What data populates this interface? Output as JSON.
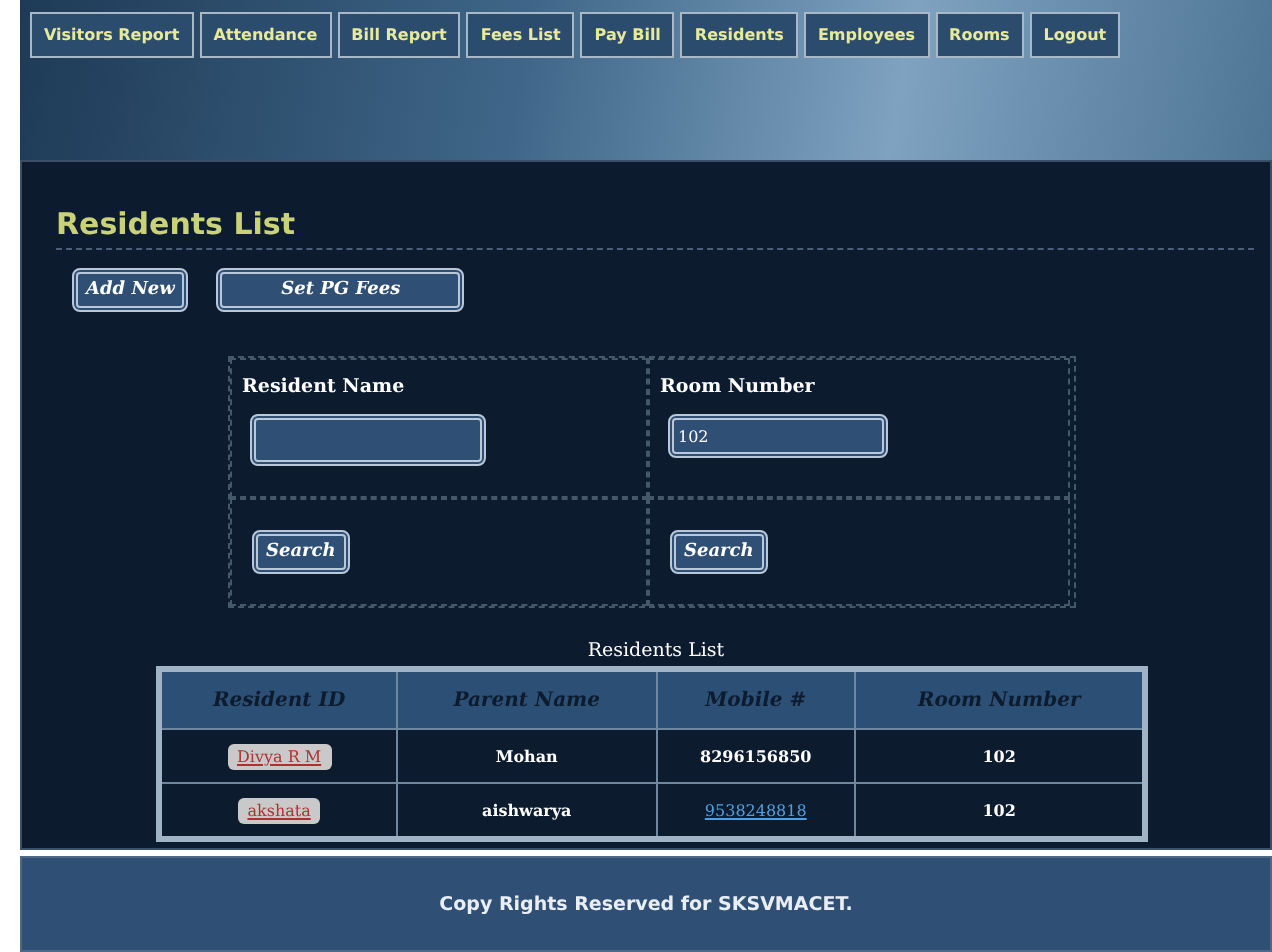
{
  "nav": [
    {
      "label": "Visitors Report"
    },
    {
      "label": "Attendance"
    },
    {
      "label": "Bill Report"
    },
    {
      "label": "Fees List"
    },
    {
      "label": "Pay Bill"
    },
    {
      "label": "Residents"
    },
    {
      "label": "Employees"
    },
    {
      "label": "Rooms"
    },
    {
      "label": "Logout"
    }
  ],
  "page_title": "Residents List",
  "actions": [
    "Add New",
    "Set PG Fees"
  ],
  "search": [
    {
      "label": "Resident Name",
      "button": "Search"
    },
    {
      "label": "Room Number",
      "value": "102",
      "button": "Search"
    }
  ],
  "table": {
    "caption": "Residents List",
    "columns": [
      "Resident ID",
      "Parent Name",
      "Mobile #",
      "Room Number"
    ],
    "rows": [
      {
        "resident_id": "Divya R M",
        "parent_name": "Mohan",
        "mobile": "8296156850",
        "mobile_link": false,
        "room": "102"
      },
      {
        "resident_id": "akshata",
        "parent_name": "aishwarya",
        "mobile": "9538248818",
        "mobile_link": true,
        "room": "102"
      }
    ]
  },
  "footer": "Copy Rights Reserved for SKSVMACET."
}
